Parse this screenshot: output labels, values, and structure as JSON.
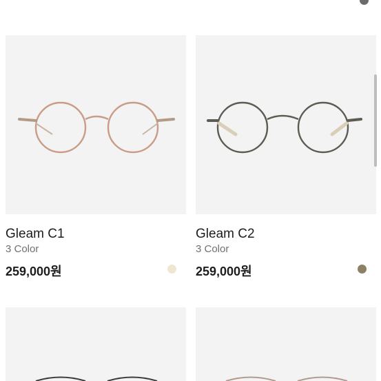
{
  "products": [
    {
      "name": "Gleam C1",
      "color_count": "3 Color",
      "price": "259,000원",
      "swatch": "#efe6d4",
      "frame_color": "#c89c86",
      "arm_color": "#b49a85"
    },
    {
      "name": "Gleam C2",
      "color_count": "3 Color",
      "price": "259,000원",
      "swatch": "#8c8165",
      "frame_color": "#5d5b52",
      "arm_color": "#d9cfb8"
    }
  ],
  "row_above": {
    "price_partial": "",
    "swatch_right": "#6b6b6b"
  },
  "row_below": [
    {
      "frame_color": "#3a3a3a"
    },
    {
      "frame_color": "#b09a8e"
    }
  ]
}
